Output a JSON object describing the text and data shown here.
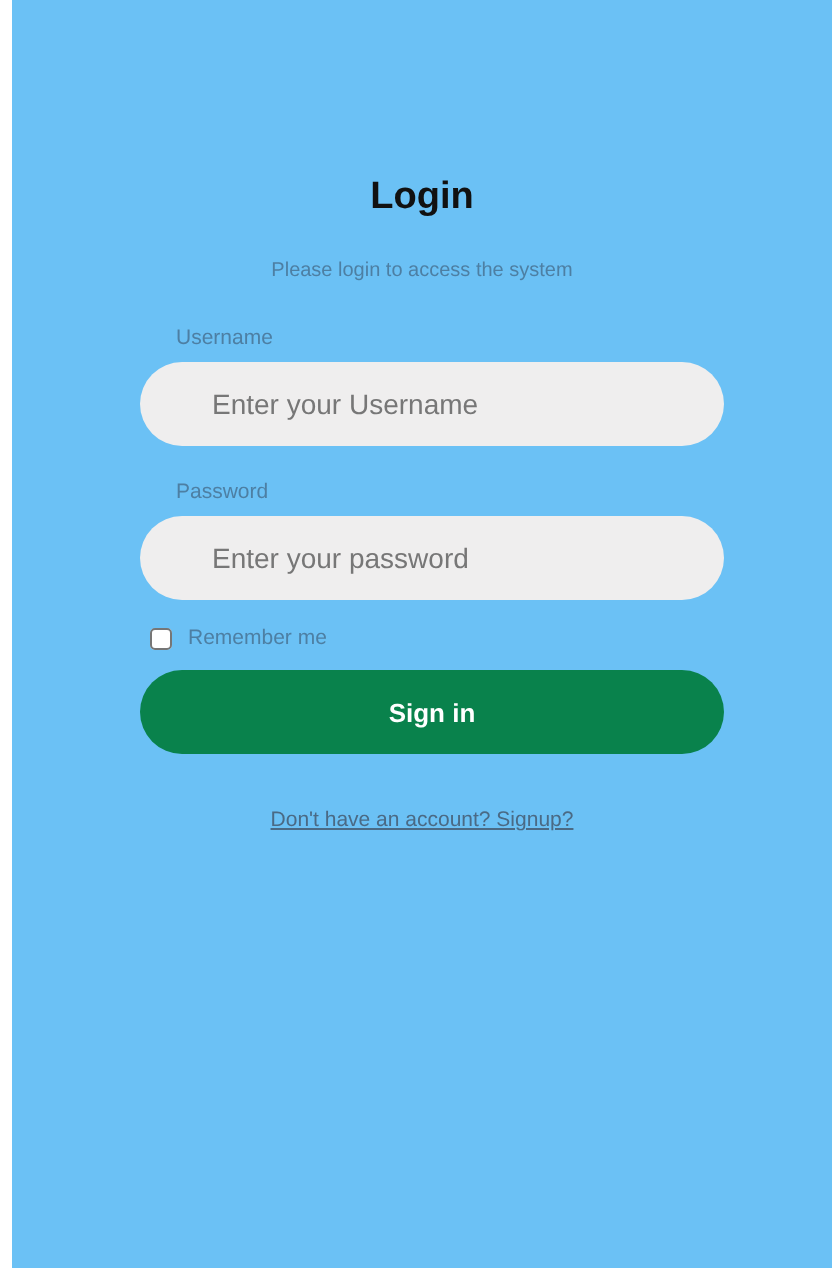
{
  "title": "Login",
  "subtitle": "Please login to access the system",
  "fields": [
    {
      "label": "Username",
      "placeholder": "Enter your Username"
    },
    {
      "label": "Password",
      "placeholder": "Enter your password"
    }
  ],
  "remember": {
    "label": "Remember me",
    "checked": false
  },
  "button": "Sign in",
  "link": "Don't have an account? Signup?"
}
